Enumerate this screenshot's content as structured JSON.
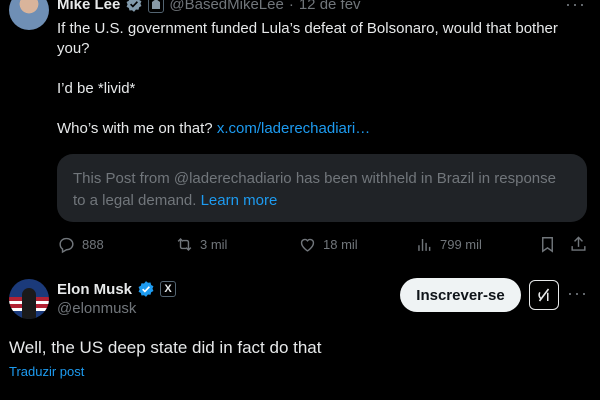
{
  "quoted_tweet": {
    "author_name": "Mike Lee",
    "author_handle": "@BasedMikeLee",
    "separator": "·",
    "date": "12 de fev",
    "text_line1": "If the U.S. government funded Lula’s defeat of Bolsonaro, would that bother you?",
    "text_line2": "I’d be *livid*",
    "text_line3_prefix": "Who’s with me on that? ",
    "text_line3_link": "x.com/laderechadiari…",
    "withheld_notice": "This Post from @laderechadiario has been withheld in Brazil in response to a legal demand.",
    "withheld_link": "Learn more",
    "replies": "888",
    "reposts": "3 mil",
    "likes": "18 mil",
    "views": "799 mil"
  },
  "main_tweet": {
    "author_name": "Elon Musk",
    "author_handle": "@elonmusk",
    "affiliate_badge": "X",
    "subscribe_label": "Inscrever-se",
    "text": "Well, the US deep state did in fact do that",
    "translate_label": "Traduzir post"
  },
  "colors": {
    "background": "#000000",
    "text": "#e7e9ea",
    "muted": "#71767b",
    "link": "#1d9bf0",
    "verified": "#1d9bf0"
  },
  "icons": [
    "verified-icon",
    "government-badge-icon",
    "more-icon",
    "reply-icon",
    "repost-icon",
    "like-icon",
    "views-icon",
    "bookmark-icon",
    "share-icon",
    "grok-icon"
  ]
}
